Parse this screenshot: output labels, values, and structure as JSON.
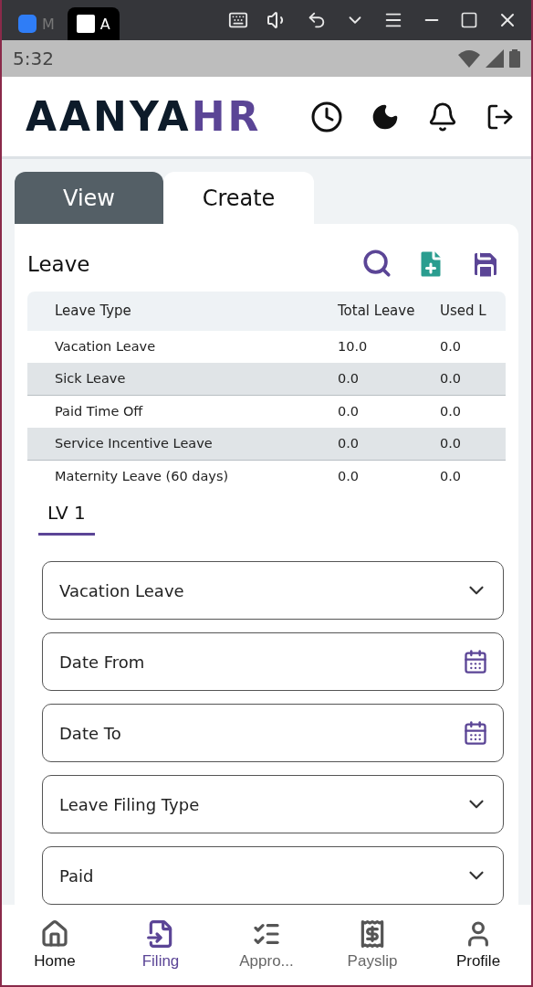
{
  "browser_tabs": [
    {
      "label": "M",
      "selected": false
    },
    {
      "label": "A",
      "selected": true
    }
  ],
  "status_bar": {
    "time": "5:32"
  },
  "logo": {
    "main": "AANYA",
    "accent": "HR"
  },
  "mode_tabs": [
    {
      "label": "View",
      "selected": false
    },
    {
      "label": "Create",
      "selected": true
    }
  ],
  "section_title": "Leave",
  "table": {
    "columns": [
      "Leave Type",
      "Total Leave",
      "Used L"
    ],
    "rows": [
      [
        "Vacation Leave",
        "10.0",
        "0.0"
      ],
      [
        "Sick Leave",
        "0.0",
        "0.0"
      ],
      [
        "Paid Time Off",
        "0.0",
        "0.0"
      ],
      [
        "Service Incentive Leave",
        "0.0",
        "0.0"
      ],
      [
        "Maternity Leave (60 days)",
        "0.0",
        "0.0"
      ]
    ]
  },
  "form_tabs": [
    {
      "label": "LV 1",
      "selected": true
    }
  ],
  "fields": [
    {
      "kind": "select",
      "value": "Vacation Leave"
    },
    {
      "kind": "date",
      "placeholder": "Date From"
    },
    {
      "kind": "date",
      "placeholder": "Date To"
    },
    {
      "kind": "select",
      "value": "Leave Filing Type"
    },
    {
      "kind": "select",
      "value": "Paid"
    }
  ],
  "bottom_nav": [
    {
      "label": "Home",
      "selected": false,
      "disabled": false
    },
    {
      "label": "Filing",
      "selected": true,
      "disabled": false
    },
    {
      "label": "Appro...",
      "selected": false,
      "disabled": true
    },
    {
      "label": "Payslip",
      "selected": false,
      "disabled": true
    },
    {
      "label": "Profile",
      "selected": false,
      "disabled": false
    }
  ]
}
